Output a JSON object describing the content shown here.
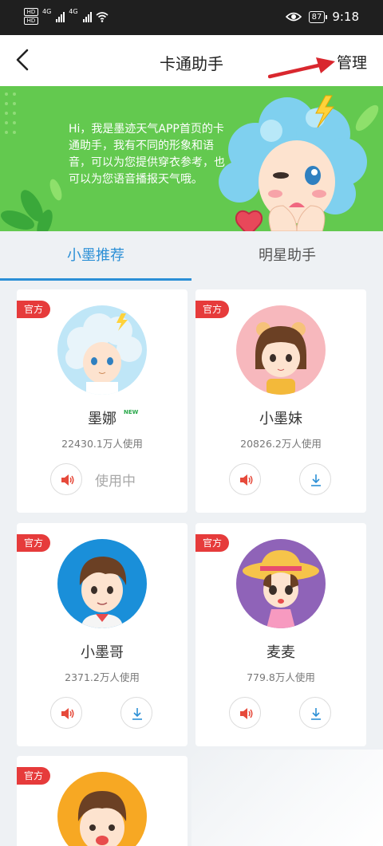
{
  "status_bar": {
    "hd1": "HD",
    "hd2": "HD",
    "net1": "4G",
    "net2": "4G",
    "battery": "87",
    "time": "9:18"
  },
  "header": {
    "title": "卡通助手",
    "manage_label": "管理",
    "annotation_color": "#d9272e"
  },
  "banner": {
    "text": "Hi，我是墨迹天气APP首页的卡通助手，我有不同的形象和语音，可以为您提供穿衣参考，也可以为您语音播报天气哦。",
    "bg_color": "#63c94f"
  },
  "tabs": [
    {
      "label": "小墨推荐",
      "active": true
    },
    {
      "label": "明星助手",
      "active": false
    }
  ],
  "colors": {
    "accent": "#2b8fd6",
    "badge": "#e63b3b",
    "voice_icon": "#e64a3b"
  },
  "assistants": [
    {
      "badge": "官方",
      "name": "墨娜",
      "new_tag": "NEW",
      "usage": "22430.1万人使用",
      "status": "使用中",
      "voice_icon": "speaker-icon",
      "avatar_bg": "#bfe6f7"
    },
    {
      "badge": "官方",
      "name": "小墨妹",
      "usage": "20826.2万人使用",
      "voice_icon": "speaker-icon",
      "action_icon": "download-icon",
      "avatar_bg": "#f7b8bd"
    },
    {
      "badge": "官方",
      "name": "小墨哥",
      "usage": "2371.2万人使用",
      "voice_icon": "speaker-icon",
      "action_icon": "download-icon",
      "avatar_bg": "#1a8fd9"
    },
    {
      "badge": "官方",
      "name": "麦麦",
      "usage": "779.8万人使用",
      "voice_icon": "speaker-icon",
      "action_icon": "download-icon",
      "avatar_bg": "#8f63b8"
    },
    {
      "badge": "官方",
      "avatar_bg": "#f7a823"
    }
  ]
}
